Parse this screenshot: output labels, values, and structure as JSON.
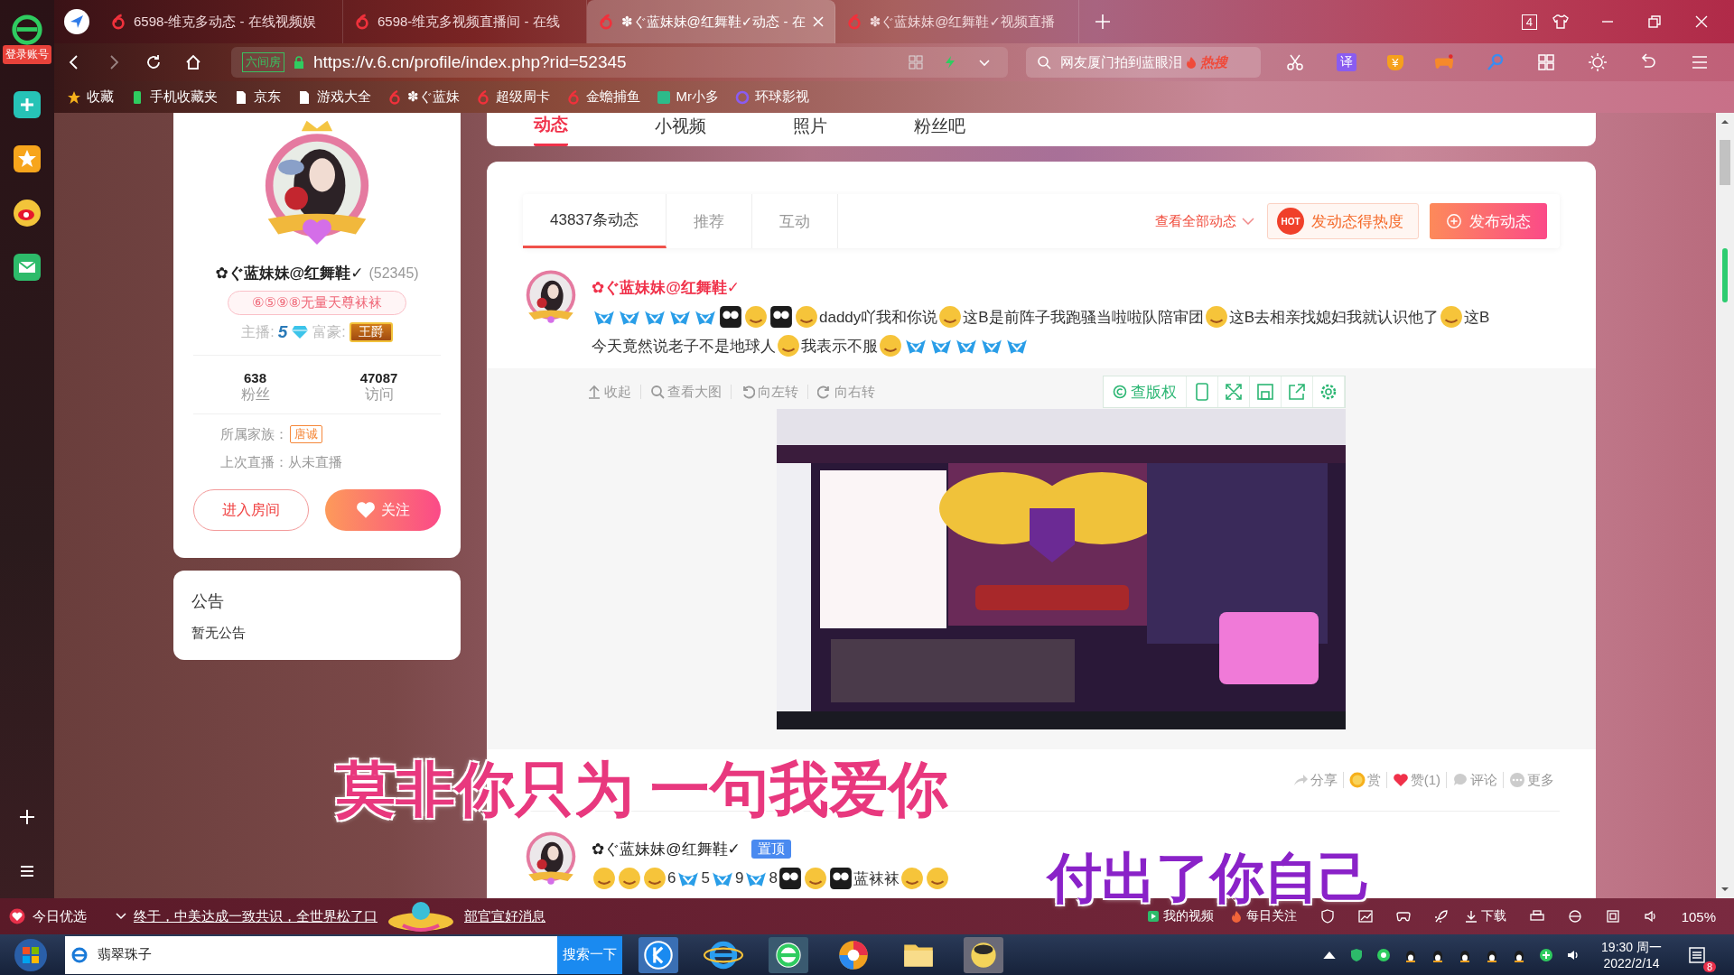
{
  "sidebar": {
    "login_badge": "登录账号"
  },
  "tabs": [
    {
      "title": "6598-维克多动态 - 在线视频娱",
      "selected": false
    },
    {
      "title": "6598-维克多视频直播间 - 在线",
      "selected": false
    },
    {
      "title": "✽ぐ蓝妹妹@红舞鞋✓动态 - 在",
      "selected": true
    },
    {
      "title": "✽ぐ蓝妹妹@红舞鞋✓视频直播",
      "selected": false
    }
  ],
  "window_count": "4",
  "address": {
    "site_badge": "六间房",
    "url": "https://v.6.cn/profile/index.php?rid=52345"
  },
  "search": {
    "value": "网友厦门拍到蓝眼泪",
    "tag": "热搜"
  },
  "toolbar": {
    "translate_label": "译",
    "coin_label": "¥"
  },
  "bookmarks": [
    {
      "label": "收藏",
      "kind": "star"
    },
    {
      "label": "手机收藏夹",
      "kind": "phone"
    },
    {
      "label": "京东",
      "kind": "page"
    },
    {
      "label": "游戏大全",
      "kind": "page"
    },
    {
      "label": "✽ぐ蓝妹",
      "kind": "six"
    },
    {
      "label": "超级周卡",
      "kind": "six"
    },
    {
      "label": "金蟾捕鱼",
      "kind": "six"
    },
    {
      "label": "Mr小多",
      "kind": "green"
    },
    {
      "label": "环球影视",
      "kind": "ring"
    }
  ],
  "nav_tabs": [
    {
      "label": "动态",
      "selected": true
    },
    {
      "label": "小视频",
      "selected": false
    },
    {
      "label": "照片",
      "selected": false
    },
    {
      "label": "粉丝吧",
      "selected": false
    }
  ],
  "profile": {
    "name": "✿ぐ蓝妹妹@红舞鞋✓",
    "room_id": "(52345)",
    "title_badge": "⑥⑤⑨⑧无量天尊袜袜",
    "anchor_label": "主播:",
    "anchor_level": "5",
    "wealth_label": "富豪:",
    "wealth_badge": "王爵",
    "stats": [
      {
        "value": "638",
        "label": "粉丝"
      },
      {
        "value": "47087",
        "label": "访问"
      }
    ],
    "family_label": "所属家族：",
    "family_badge": "唐诚",
    "last_live": "上次直播：从未直播",
    "enter_button": "进入房间",
    "follow_button": "关注"
  },
  "notice": {
    "title": "公告",
    "text": "暂无公告"
  },
  "feed": {
    "tabs": [
      {
        "label": "43837条动态",
        "selected": true
      },
      {
        "label": "推荐",
        "selected": false
      },
      {
        "label": "互动",
        "selected": false
      }
    ],
    "filter": "查看全部动态",
    "hot_badge": "HOT",
    "hot_button": "发动态得热度",
    "post_button": "发布动态",
    "posts": [
      {
        "author": "✿ぐ蓝妹妹@红舞鞋✓",
        "highlighted": true,
        "pinned": false,
        "content": [
          {
            "kind": "five"
          },
          {
            "kind": "five"
          },
          {
            "kind": "five"
          },
          {
            "kind": "five"
          },
          {
            "kind": "five"
          },
          {
            "kind": "dark"
          },
          {
            "kind": "face"
          },
          {
            "kind": "dark"
          },
          {
            "kind": "face"
          },
          {
            "kind": "text",
            "text": "daddy吖我和你说"
          },
          {
            "kind": "face"
          },
          {
            "kind": "text",
            "text": "这B是前阵子我跑骚当啦啦队陪审团"
          },
          {
            "kind": "face"
          },
          {
            "kind": "text",
            "text": "这B去相亲找媳妇我就认识他了"
          },
          {
            "kind": "face"
          },
          {
            "kind": "text",
            "text": "这B"
          },
          {
            "kind": "text",
            "text": "今天竟然说老子不是地球人"
          },
          {
            "kind": "face"
          },
          {
            "kind": "text",
            "text": "我表示不服"
          },
          {
            "kind": "face"
          },
          {
            "kind": "five"
          },
          {
            "kind": "five"
          },
          {
            "kind": "five"
          },
          {
            "kind": "five"
          },
          {
            "kind": "five"
          }
        ],
        "tools": [
          {
            "kind": "collapse",
            "label": "收起"
          },
          {
            "kind": "view",
            "label": "查看大图"
          },
          {
            "kind": "rotate_left",
            "label": "向左转"
          },
          {
            "kind": "rotate_right",
            "label": "向右转"
          }
        ],
        "copyright_button": "查版权",
        "media": {
          "kind": "picture"
        },
        "actions": [
          {
            "kind": "share",
            "label": "分享"
          },
          {
            "kind": "tip",
            "label": "赏"
          },
          {
            "kind": "like",
            "label": "赞(1)"
          },
          {
            "kind": "comment",
            "label": "评论"
          },
          {
            "kind": "more",
            "label": "更多"
          }
        ]
      },
      {
        "author": "✿ぐ蓝妹妹@红舞鞋✓",
        "highlighted": false,
        "pinned": true,
        "pin_label": "置顶",
        "content": [
          {
            "kind": "face"
          },
          {
            "kind": "face"
          },
          {
            "kind": "face"
          },
          {
            "kind": "text",
            "text": "6"
          },
          {
            "kind": "five"
          },
          {
            "kind": "text",
            "text": "5"
          },
          {
            "kind": "five"
          },
          {
            "kind": "text",
            "text": "9"
          },
          {
            "kind": "five"
          },
          {
            "kind": "text",
            "text": "8"
          },
          {
            "kind": "dark"
          },
          {
            "kind": "face"
          },
          {
            "kind": "dark"
          },
          {
            "kind": "text",
            "text": "蓝袜袜"
          },
          {
            "kind": "face"
          },
          {
            "kind": "face"
          }
        ]
      }
    ]
  },
  "lyrics": [
    "莫非你只为 一句我爱你",
    "付出了你自己"
  ],
  "news_bar": {
    "label": "今日优选",
    "headline": "终于，中美达成一致共识，全世界松了口",
    "headline_tail": "部官宣好消息",
    "my_videos": "我的视频",
    "daily": "每日关注",
    "download": "下载",
    "zoom": "105%"
  },
  "taskbar": {
    "search_value": "翡翠珠子",
    "search_button": "搜索一下",
    "time": "19:30 周一",
    "date": "2022/2/14",
    "notification_count": "8"
  }
}
